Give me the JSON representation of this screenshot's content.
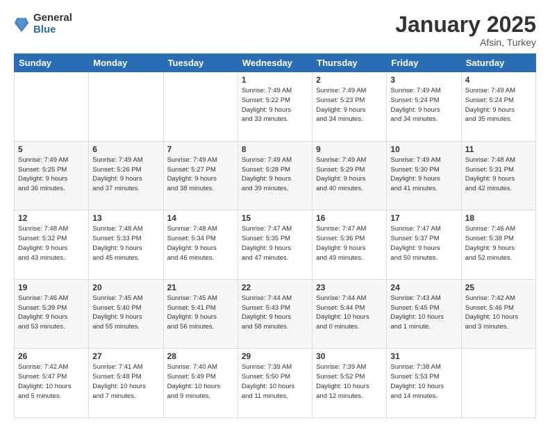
{
  "logo": {
    "general": "General",
    "blue": "Blue"
  },
  "header": {
    "month": "January 2025",
    "location": "Afsin, Turkey"
  },
  "weekdays": [
    "Sunday",
    "Monday",
    "Tuesday",
    "Wednesday",
    "Thursday",
    "Friday",
    "Saturday"
  ],
  "weeks": [
    [
      {
        "day": "",
        "info": ""
      },
      {
        "day": "",
        "info": ""
      },
      {
        "day": "",
        "info": ""
      },
      {
        "day": "1",
        "info": "Sunrise: 7:49 AM\nSunset: 5:22 PM\nDaylight: 9 hours\nand 33 minutes."
      },
      {
        "day": "2",
        "info": "Sunrise: 7:49 AM\nSunset: 5:23 PM\nDaylight: 9 hours\nand 34 minutes."
      },
      {
        "day": "3",
        "info": "Sunrise: 7:49 AM\nSunset: 5:24 PM\nDaylight: 9 hours\nand 34 minutes."
      },
      {
        "day": "4",
        "info": "Sunrise: 7:49 AM\nSunset: 5:24 PM\nDaylight: 9 hours\nand 35 minutes."
      }
    ],
    [
      {
        "day": "5",
        "info": "Sunrise: 7:49 AM\nSunset: 5:25 PM\nDaylight: 9 hours\nand 36 minutes."
      },
      {
        "day": "6",
        "info": "Sunrise: 7:49 AM\nSunset: 5:26 PM\nDaylight: 9 hours\nand 37 minutes."
      },
      {
        "day": "7",
        "info": "Sunrise: 7:49 AM\nSunset: 5:27 PM\nDaylight: 9 hours\nand 38 minutes."
      },
      {
        "day": "8",
        "info": "Sunrise: 7:49 AM\nSunset: 5:28 PM\nDaylight: 9 hours\nand 39 minutes."
      },
      {
        "day": "9",
        "info": "Sunrise: 7:49 AM\nSunset: 5:29 PM\nDaylight: 9 hours\nand 40 minutes."
      },
      {
        "day": "10",
        "info": "Sunrise: 7:49 AM\nSunset: 5:30 PM\nDaylight: 9 hours\nand 41 minutes."
      },
      {
        "day": "11",
        "info": "Sunrise: 7:48 AM\nSunset: 5:31 PM\nDaylight: 9 hours\nand 42 minutes."
      }
    ],
    [
      {
        "day": "12",
        "info": "Sunrise: 7:48 AM\nSunset: 5:32 PM\nDaylight: 9 hours\nand 43 minutes."
      },
      {
        "day": "13",
        "info": "Sunrise: 7:48 AM\nSunset: 5:33 PM\nDaylight: 9 hours\nand 45 minutes."
      },
      {
        "day": "14",
        "info": "Sunrise: 7:48 AM\nSunset: 5:34 PM\nDaylight: 9 hours\nand 46 minutes."
      },
      {
        "day": "15",
        "info": "Sunrise: 7:47 AM\nSunset: 5:35 PM\nDaylight: 9 hours\nand 47 minutes."
      },
      {
        "day": "16",
        "info": "Sunrise: 7:47 AM\nSunset: 5:36 PM\nDaylight: 9 hours\nand 49 minutes."
      },
      {
        "day": "17",
        "info": "Sunrise: 7:47 AM\nSunset: 5:37 PM\nDaylight: 9 hours\nand 50 minutes."
      },
      {
        "day": "18",
        "info": "Sunrise: 7:46 AM\nSunset: 5:38 PM\nDaylight: 9 hours\nand 52 minutes."
      }
    ],
    [
      {
        "day": "19",
        "info": "Sunrise: 7:46 AM\nSunset: 5:39 PM\nDaylight: 9 hours\nand 53 minutes."
      },
      {
        "day": "20",
        "info": "Sunrise: 7:45 AM\nSunset: 5:40 PM\nDaylight: 9 hours\nand 55 minutes."
      },
      {
        "day": "21",
        "info": "Sunrise: 7:45 AM\nSunset: 5:41 PM\nDaylight: 9 hours\nand 56 minutes."
      },
      {
        "day": "22",
        "info": "Sunrise: 7:44 AM\nSunset: 5:43 PM\nDaylight: 9 hours\nand 58 minutes."
      },
      {
        "day": "23",
        "info": "Sunrise: 7:44 AM\nSunset: 5:44 PM\nDaylight: 10 hours\nand 0 minutes."
      },
      {
        "day": "24",
        "info": "Sunrise: 7:43 AM\nSunset: 5:45 PM\nDaylight: 10 hours\nand 1 minute."
      },
      {
        "day": "25",
        "info": "Sunrise: 7:42 AM\nSunset: 5:46 PM\nDaylight: 10 hours\nand 3 minutes."
      }
    ],
    [
      {
        "day": "26",
        "info": "Sunrise: 7:42 AM\nSunset: 5:47 PM\nDaylight: 10 hours\nand 5 minutes."
      },
      {
        "day": "27",
        "info": "Sunrise: 7:41 AM\nSunset: 5:48 PM\nDaylight: 10 hours\nand 7 minutes."
      },
      {
        "day": "28",
        "info": "Sunrise: 7:40 AM\nSunset: 5:49 PM\nDaylight: 10 hours\nand 9 minutes."
      },
      {
        "day": "29",
        "info": "Sunrise: 7:39 AM\nSunset: 5:50 PM\nDaylight: 10 hours\nand 11 minutes."
      },
      {
        "day": "30",
        "info": "Sunrise: 7:39 AM\nSunset: 5:52 PM\nDaylight: 10 hours\nand 12 minutes."
      },
      {
        "day": "31",
        "info": "Sunrise: 7:38 AM\nSunset: 5:53 PM\nDaylight: 10 hours\nand 14 minutes."
      },
      {
        "day": "",
        "info": ""
      }
    ]
  ]
}
